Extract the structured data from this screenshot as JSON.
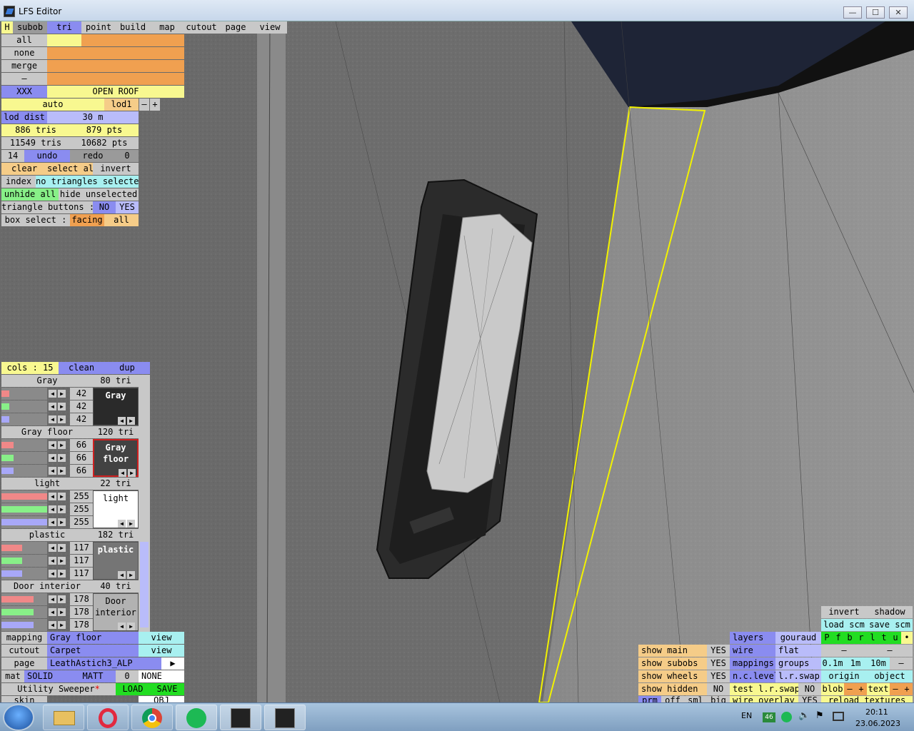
{
  "window": {
    "title": "LFS Editor",
    "minimize": "—",
    "maximize": "☐",
    "close": "✕"
  },
  "tabs": {
    "h": "H",
    "items": [
      "subob",
      "tri",
      "point",
      "build",
      "map",
      "cutout",
      "page",
      "view"
    ]
  },
  "left_rows": {
    "all": "all",
    "none": "none",
    "merge": "merge",
    "dash": "–",
    "xxx": "XXX",
    "open_roof": "OPEN ROOF",
    "auto": "auto",
    "lod": "lod1",
    "minus": "–",
    "plus": "+"
  },
  "lod_dist": {
    "label": "lod dist",
    "value": "30 m"
  },
  "counts": {
    "tris1": "886 tris",
    "pts1": "879 pts",
    "tris2": "11549 tris",
    "pts2": "10682 pts"
  },
  "undo_row": {
    "num": "14",
    "undo": "undo",
    "redo": "redo",
    "zero": "0"
  },
  "select_row": {
    "clear": "clear",
    "select_all": "select all",
    "invert": "invert"
  },
  "index_row": {
    "index": "index",
    "status": "no triangles selected"
  },
  "unhide_row": {
    "unhide": "unhide all",
    "hide": "hide unselected"
  },
  "tribtn_row": {
    "label": "triangle buttons :",
    "no": "NO",
    "yes": "YES"
  },
  "box_row": {
    "label": "box select :",
    "facing": "facing",
    "all": "all"
  },
  "cols_row": {
    "cols": "cols : 15",
    "clean": "clean",
    "dup": "dup"
  },
  "materials": [
    {
      "name": "Gray",
      "tri": "80 tri",
      "rgb": [
        "42",
        "42",
        "42"
      ],
      "swatch_label": "Gray",
      "swatch_color": "#2a2a2a"
    },
    {
      "name": "Gray floor",
      "tri": "120 tri",
      "rgb": [
        "66",
        "66",
        "66"
      ],
      "swatch_label": "Gray floor",
      "swatch_color": "#424242"
    },
    {
      "name": "light",
      "tri": "22 tri",
      "rgb": [
        "255",
        "255",
        "255"
      ],
      "swatch_label": "light",
      "swatch_color": "#ffffff"
    },
    {
      "name": "plastic",
      "tri": "182 tri",
      "rgb": [
        "117",
        "117",
        "117"
      ],
      "swatch_label": "plastic",
      "swatch_color": "#757575"
    },
    {
      "name": "Door interior",
      "tri": "40 tri",
      "rgb": [
        "178",
        "178",
        "178"
      ],
      "swatch_label": "Door interior",
      "swatch_color": "#b2b2b2"
    }
  ],
  "bottom_left": {
    "mapping": "mapping",
    "mapping_val": "Gray floor",
    "view1": "view",
    "cutout": "cutout",
    "cutout_val": "Carpet",
    "view2": "view",
    "page": "page",
    "page_val": "LeathAstich3_ALP",
    "page_arrow": "▶",
    "mat": "mat",
    "solid": "SOLID",
    "matt": "MATT",
    "zero": "0",
    "none": "NONE",
    "utility": "Utility Sweeper",
    "utility_star": "*",
    "load": "LOAD",
    "save": "SAVE",
    "skin": "skin",
    "obj": "OBJ"
  },
  "bottom_right": {
    "invert": "invert",
    "shadow": "shadow",
    "load_scm": "load scm",
    "save_scm": "save scm",
    "layers": "layers",
    "gouraud": "gouraud",
    "pfbrltu": [
      "P",
      "f",
      "b",
      "r",
      "l",
      "t",
      "u"
    ],
    "dot": "•",
    "show_main": "show main",
    "yes1": "YES",
    "wire": "wire",
    "flat": "flat",
    "dash1": "–",
    "dash2": "–",
    "show_subobs": "show subobs",
    "yes2": "YES",
    "mappings": "mappings",
    "groups": "groups",
    "m01": "0.1m",
    "m1": "1m",
    "m10": "10m",
    "dash3": "–",
    "show_wheels": "show wheels",
    "yes3": "YES",
    "nclevel": "n.c.level",
    "lrswap": "l.r.swap",
    "origin": "origin",
    "object": "object",
    "show_hidden": "show hidden",
    "no1": "NO",
    "test_lrswap": "test l.r.swap",
    "no2": "NO",
    "blob": "blob",
    "text": "text",
    "prm": "prm",
    "off": "off",
    "sml": "sml",
    "big": "big",
    "wire_overlay": "wire overlay",
    "yes4": "YES",
    "reload_textures": "reload textures"
  },
  "taskbar": {
    "lang": "EN",
    "badge": "46",
    "time": "20:11",
    "date": "23.06.2023"
  }
}
